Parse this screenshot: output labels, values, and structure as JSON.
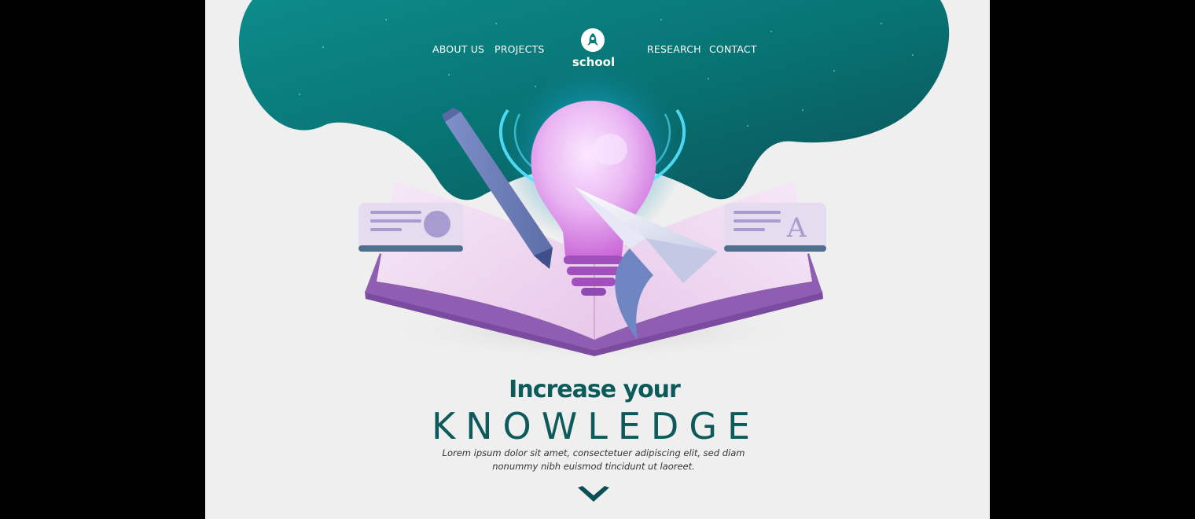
{
  "nav": {
    "left": [
      "ABOUT US",
      "PROJECTS"
    ],
    "right": [
      "RESEARCH",
      "CONTACT"
    ]
  },
  "logo": {
    "text": "school",
    "icon": "rocket-icon"
  },
  "hero": {
    "headline_line1": "Increase your",
    "headline_line2": "KNOWLEDGE",
    "body": "Lorem ipsum dolor sit amet, consectetuer adipiscing elit, sed diam nonummy nibh euismod tincidunt ut laoreet.",
    "scroll_icon": "chevron-down-icon",
    "right_card_glyph": "A"
  },
  "colors": {
    "teal_dark": "#0b4f55",
    "teal": "#0a7a7c",
    "headline": "#0d5a5a",
    "page_bg": "#efefef",
    "book_purple": "#7a4b9e",
    "bulb_pink": "#e9b5f0"
  }
}
